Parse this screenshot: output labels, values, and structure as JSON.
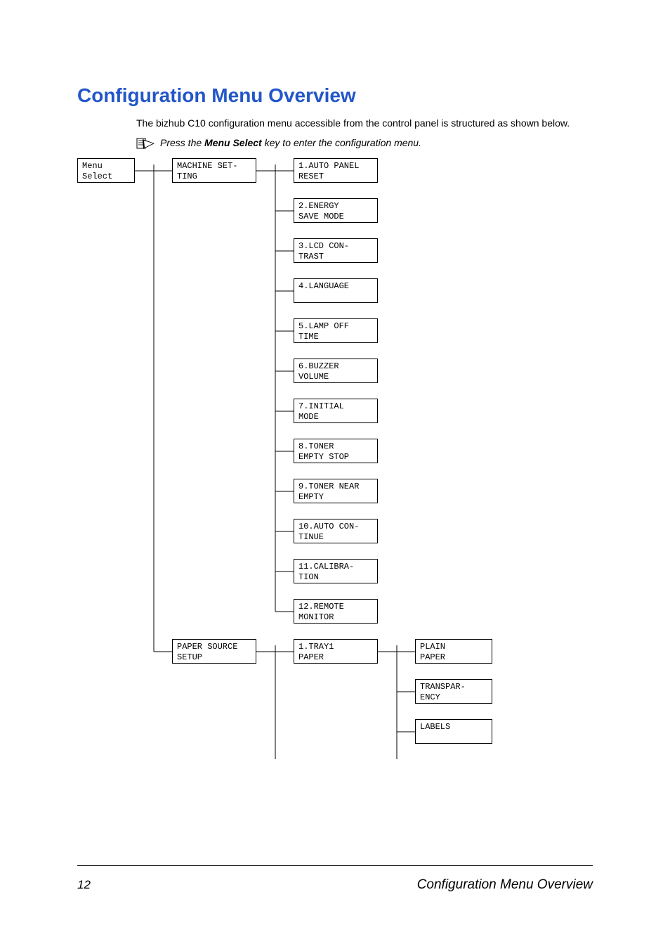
{
  "title": "Configuration Menu Overview",
  "intro": "The bizhub C10 configuration menu accessible from the control panel is structured as shown below.",
  "note_prefix": "Press the ",
  "note_bold": "Menu Select",
  "note_suffix": " key to enter the configuration menu.",
  "menu_select_1": "Menu",
  "menu_select_2": "Select",
  "machine_setting_1": "MACHINE SET-",
  "machine_setting_2": "TING",
  "ms": {
    "i1a": "1.AUTO PANEL",
    "i1b": "RESET",
    "i2a": "2.ENERGY",
    "i2b": "SAVE MODE",
    "i3a": "3.LCD CON-",
    "i3b": "TRAST",
    "i4a": "4.LANGUAGE",
    "i4b": "",
    "i5a": "5.LAMP OFF",
    "i5b": "TIME",
    "i6a": "6.BUZZER",
    "i6b": "VOLUME",
    "i7a": "7.INITIAL",
    "i7b": "MODE",
    "i8a": "8.TONER",
    "i8b": "EMPTY STOP",
    "i9a": "9.TONER NEAR",
    "i9b": "EMPTY",
    "i10a": "10.AUTO CON-",
    "i10b": "TINUE",
    "i11a": "11.CALIBRA-",
    "i11b": "TION",
    "i12a": "12.REMOTE",
    "i12b": "MONITOR"
  },
  "paper_source_1": "PAPER SOURCE",
  "paper_source_2": "SETUP",
  "tray1a": "1.TRAY1",
  "tray1b": "PAPER",
  "paper_types": {
    "p1a": "PLAIN",
    "p1b": "PAPER",
    "p2a": "TRANSPAR-",
    "p2b": "ENCY",
    "p3a": "LABELS",
    "p3b": ""
  },
  "footer": {
    "page_number": "12",
    "page_title": "Configuration Menu Overview"
  }
}
